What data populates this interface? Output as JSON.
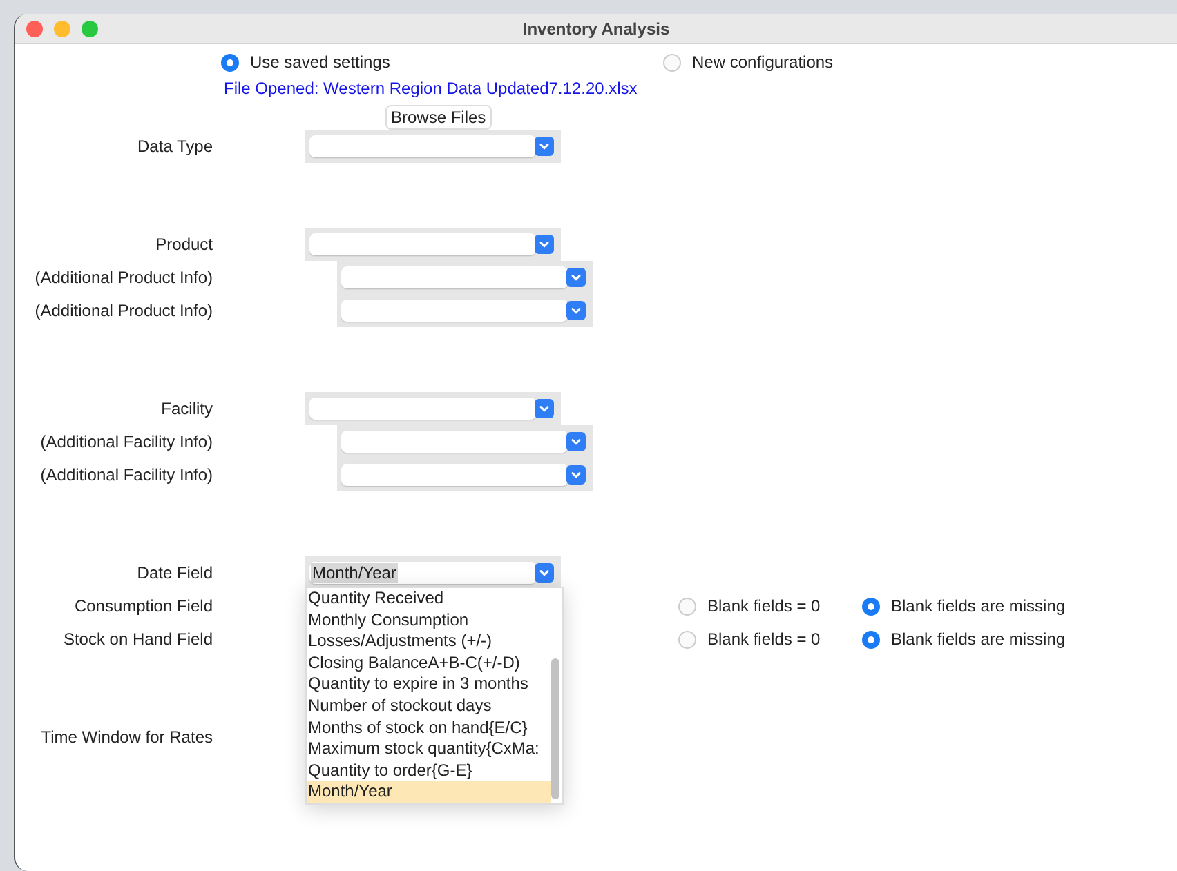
{
  "window": {
    "title": "Inventory Analysis"
  },
  "source_options": [
    {
      "label": "Use saved settings",
      "selected": true
    },
    {
      "label": "New configurations",
      "selected": false
    }
  ],
  "file_status": "File Opened: Western Region Data Updated7.12.20.xlsx",
  "browse_button": "Browse Files",
  "sections": [
    {
      "rows": [
        {
          "kind": "select",
          "label": "Data Type"
        }
      ]
    },
    {
      "rows": [
        {
          "kind": "select",
          "label": "Product"
        },
        {
          "kind": "sub_select",
          "label": "(Additional Product Info)"
        },
        {
          "kind": "sub_select",
          "label": "(Additional Product Info)"
        }
      ]
    },
    {
      "rows": [
        {
          "kind": "select",
          "label": "Facility"
        },
        {
          "kind": "sub_select",
          "label": "(Additional Facility Info)"
        },
        {
          "kind": "sub_select",
          "label": "(Additional Facility Info)"
        }
      ]
    },
    {
      "rows": [
        {
          "kind": "open_select",
          "label": "Date Field",
          "value": "Month/Year",
          "options": [
            {
              "label": "Quantity Received",
              "selected": false
            },
            {
              "label": "Monthly Consumption",
              "selected": false
            },
            {
              "label": "Losses/Adjustments (+/-)",
              "selected": false
            },
            {
              "label": "Closing BalanceA+B-C(+/-D)",
              "selected": false
            },
            {
              "label": "Quantity to expire in 3 months",
              "selected": false
            },
            {
              "label": "Number of stockout days",
              "selected": false
            },
            {
              "label": "Months of stock on hand{E/C}",
              "selected": false
            },
            {
              "label": "Maximum stock quantity{CxMa:",
              "selected": false
            },
            {
              "label": "Quantity to order{G-E}",
              "selected": false
            },
            {
              "label": "Month/Year",
              "selected": true
            }
          ]
        },
        {
          "kind": "blank_choice",
          "label": "Consumption Field",
          "options": [
            {
              "label": "Blank fields = 0",
              "selected": false
            },
            {
              "label": "Blank fields are missing",
              "selected": true
            }
          ]
        },
        {
          "kind": "blank_choice",
          "label": "Stock on Hand Field",
          "options": [
            {
              "label": "Blank fields = 0",
              "selected": false
            },
            {
              "label": "Blank fields are missing",
              "selected": true
            }
          ]
        }
      ]
    },
    {
      "rows": [
        {
          "kind": "label_only",
          "label": "Time Window for Rates"
        }
      ]
    }
  ]
}
